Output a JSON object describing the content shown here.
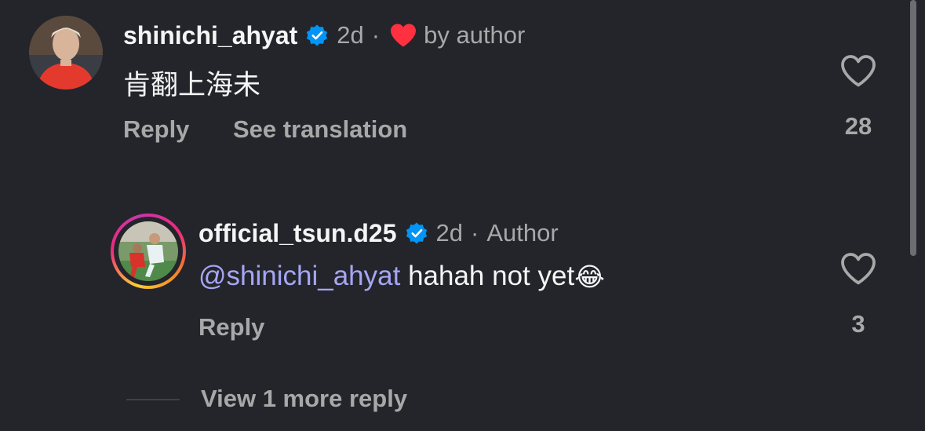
{
  "comment": {
    "username": "shinichi_ahyat",
    "time": "2d",
    "separator": "·",
    "liked_by": "by author",
    "text": "肯翻上海未",
    "reply_label": "Reply",
    "translate_label": "See translation",
    "like_count": "28"
  },
  "reply": {
    "username": "official_tsun.d25",
    "time": "2d",
    "separator": "·",
    "role": "Author",
    "mention": "@shinichi_ahyat",
    "text": " hahah not yet",
    "emoji": "😂",
    "reply_label": "Reply",
    "like_count": "3"
  },
  "view_more": {
    "label": "View 1 more reply"
  },
  "colors": {
    "background": "#23252b",
    "verified": "#0095f6",
    "heart": "#ff3040",
    "mention": "#a6a6f5",
    "muted": "#a8a8a8"
  }
}
